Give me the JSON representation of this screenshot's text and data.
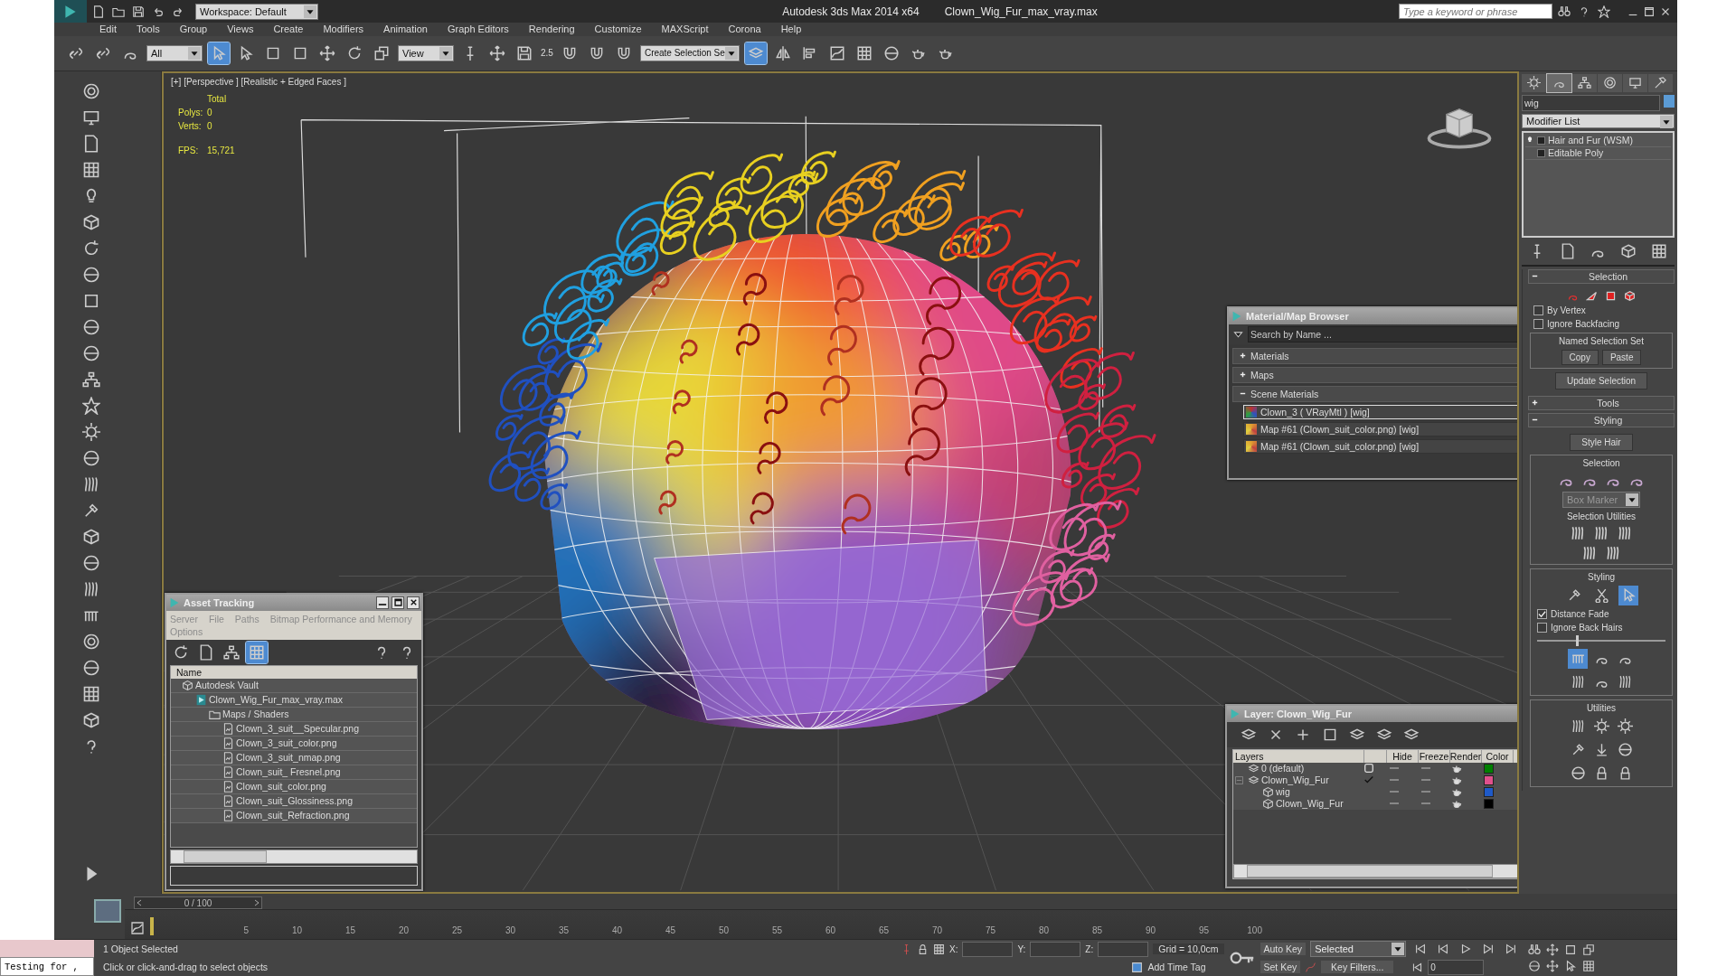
{
  "title_bar": {
    "workspace": "Workspace: Default",
    "app_title": "Autodesk 3ds Max  2014 x64",
    "file_name": "Clown_Wig_Fur_max_vray.max",
    "search_placeholder": "Type a keyword or phrase"
  },
  "menu": [
    "Edit",
    "Tools",
    "Group",
    "Views",
    "Create",
    "Modifiers",
    "Animation",
    "Graph Editors",
    "Rendering",
    "Customize",
    "MAXScript",
    "Corona",
    "Help"
  ],
  "toolbar": {
    "selection_filter": "All",
    "reference_coord": "View",
    "snap_value": "2.5",
    "named_selection": "Create Selection Se",
    "tools": [
      {
        "selected": false
      },
      {
        "selected": false
      },
      {
        "selected": false
      },
      {
        "selected": true
      },
      {
        "selected": false
      },
      {
        "selected": false
      },
      {
        "selected": false
      },
      {
        "selected": false
      },
      {
        "selected": false
      },
      {
        "selected": false
      },
      {
        "selected": false
      },
      {
        "selected": false
      },
      {
        "selected": false
      },
      {
        "selected": false
      },
      {
        "selected": false
      },
      {
        "selected": false
      },
      {
        "selected": true
      },
      {
        "selected": false
      },
      {
        "selected": false
      },
      {
        "selected": false
      },
      {
        "selected": false
      },
      {
        "selected": false
      },
      {
        "selected": false
      },
      {
        "selected": false
      }
    ]
  },
  "viewport": {
    "label": "[+] [Perspective ] [Realistic + Edged Faces ]",
    "stats_heading": "Total",
    "stats": [
      {
        "label": "Polys:",
        "value": "0"
      },
      {
        "label": "Verts:",
        "value": "0"
      }
    ],
    "fps_label": "FPS:",
    "fps_value": "15,721"
  },
  "material_browser": {
    "title": "Material/Map Browser",
    "search_placeholder": "Search by Name ...",
    "groups": [
      {
        "label": "Materials",
        "expanded": false
      },
      {
        "label": "Maps",
        "expanded": false
      },
      {
        "label": "Scene Materials",
        "expanded": true
      }
    ],
    "items": [
      {
        "label": "Clown_3  ( VRayMtl ) [wig]",
        "kind": "material",
        "selected": true
      },
      {
        "label": "Map #61 (Clown_suit_color.png)  [wig]",
        "kind": "map",
        "selected": false
      },
      {
        "label": "Map #61 (Clown_suit_color.png)  [wig]",
        "kind": "map",
        "selected": false
      }
    ]
  },
  "asset_tracking": {
    "title": "Asset Tracking",
    "menu": [
      "Server",
      "File",
      "Paths",
      "Bitmap Performance and Memory",
      "Options"
    ],
    "view_buttons": [
      {
        "selected": false
      },
      {
        "selected": false
      },
      {
        "selected": false
      },
      {
        "selected": true
      }
    ],
    "column": "Name",
    "tree": [
      {
        "label": "Autodesk Vault",
        "kind": "vault",
        "children": [
          {
            "label": "Clown_Wig_Fur_max_vray.max",
            "kind": "scene",
            "children": [
              {
                "label": "Maps / Shaders",
                "kind": "folder",
                "children": [
                  {
                    "label": "Clown_3_suit__Specular.png",
                    "kind": "image"
                  },
                  {
                    "label": "Clown_3_suit_color.png",
                    "kind": "image"
                  },
                  {
                    "label": "Clown_3_suit_nmap.png",
                    "kind": "image"
                  },
                  {
                    "label": "Clown_suit_ Fresnel.png",
                    "kind": "image"
                  },
                  {
                    "label": "Clown_suit_color.png",
                    "kind": "image"
                  },
                  {
                    "label": "Clown_suit_Glossiness.png",
                    "kind": "image"
                  },
                  {
                    "label": "Clown_suit_Refraction.png",
                    "kind": "image"
                  }
                ]
              }
            ]
          }
        ]
      }
    ]
  },
  "layer_panel": {
    "title": "Layer: Clown_Wig_Fur",
    "columns": [
      "Layers",
      "Hide",
      "Freeze",
      "Render",
      "Color"
    ],
    "rows": [
      {
        "name": "0 (default)",
        "kind": "layer",
        "current": false,
        "color": "#008000"
      },
      {
        "name": "Clown_Wig_Fur",
        "kind": "layer",
        "current": true,
        "expanded": true,
        "color": "#e0508c",
        "children": [
          {
            "name": "wig",
            "kind": "object",
            "color": "#1f5ac8"
          },
          {
            "name": "Clown_Wig_Fur",
            "kind": "object",
            "color": "#000000"
          }
        ]
      }
    ]
  },
  "command_panel": {
    "tabs": [
      {
        "selected": false
      },
      {
        "selected": true
      },
      {
        "selected": false
      },
      {
        "selected": false
      },
      {
        "selected": false
      },
      {
        "selected": false
      }
    ],
    "object_name": "wig",
    "modifier_list": "Modifier List",
    "stack": [
      {
        "label": "Hair and Fur (WSM)",
        "kind": "modifier"
      },
      {
        "label": "Editable Poly",
        "kind": "base"
      }
    ],
    "selection_rollout": {
      "title": "Selection",
      "expanded": true,
      "checkboxes": [
        {
          "label": "By Vertex",
          "checked": false
        },
        {
          "label": "Ignore Backfacing",
          "checked": false
        }
      ],
      "named_set_title": "Named Selection Set",
      "named_set_buttons": [
        "Copy",
        "Paste"
      ],
      "update_button": "Update Selection"
    },
    "tools_rollout": {
      "title": "Tools",
      "expanded": false
    },
    "styling_rollout": {
      "title": "Styling",
      "expanded": true,
      "style_button": "Style Hair",
      "selection_group": "Selection",
      "marker_dropdown": "Box Marker",
      "utilities_label": "Selection Utilities",
      "styling_group": "Styling",
      "brush_tools": [
        {
          "selected": false
        },
        {
          "selected": false
        },
        {
          "selected": true
        }
      ],
      "checkboxes": [
        {
          "label": "Distance Fade",
          "checked": true
        },
        {
          "label": "Ignore Back Hairs",
          "checked": false
        }
      ],
      "level": 0.3,
      "mode_tools": [
        {
          "selected": true
        },
        {
          "selected": false
        },
        {
          "selected": false
        },
        {
          "selected": false
        },
        {
          "selected": false
        },
        {
          "selected": false
        }
      ],
      "utilities_group": "Utilities"
    }
  },
  "timeline": {
    "position": "0 / 100",
    "level": 0,
    "ticks": [
      "5",
      "10",
      "15",
      "20",
      "25",
      "30",
      "35",
      "40",
      "45",
      "50",
      "55",
      "60",
      "65",
      "70",
      "75",
      "80",
      "85",
      "90",
      "95",
      "100"
    ]
  },
  "status_bar": {
    "script_listener": "Testing for ,",
    "selection_info": "1 Object Selected",
    "prompt": "Click or click-and-drag to select objects",
    "x_label": "X:",
    "y_label": "Y:",
    "z_label": "Z:",
    "grid": "Grid = 10,0cm",
    "time_tag": "Add Time Tag",
    "auto_key": "Auto Key",
    "key_mode": "Selected",
    "set_key": "Set Key",
    "key_filters": "Key Filters...",
    "frame": "0"
  }
}
